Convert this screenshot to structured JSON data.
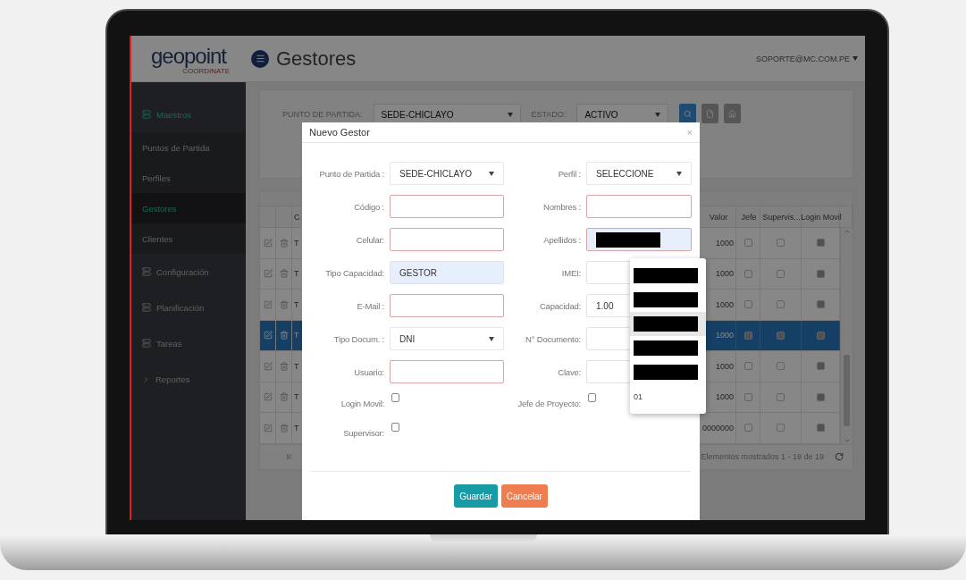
{
  "header": {
    "logo": "geopoint",
    "logo_tagline": "COORDINATE",
    "title": "Gestores",
    "user": "SOPORTE@MC.COM.PE"
  },
  "sidebar": {
    "items": [
      {
        "label": "Maestros",
        "kind": "section",
        "selected": true
      },
      {
        "label": "Puntos de Partida",
        "kind": "link",
        "selected": false
      },
      {
        "label": "Perfiles",
        "kind": "link",
        "selected": false
      },
      {
        "label": "Gestores",
        "kind": "link",
        "selected": true
      },
      {
        "label": "Clientes",
        "kind": "link",
        "selected": false
      },
      {
        "label": "Configuración",
        "kind": "section",
        "selected": false
      },
      {
        "label": "Planificación",
        "kind": "section",
        "selected": false
      },
      {
        "label": "Tareas",
        "kind": "section",
        "selected": false
      },
      {
        "label": "Reportes",
        "kind": "group",
        "selected": false
      }
    ]
  },
  "filters": [
    {
      "label": "PUNTO DE PARTIDA:",
      "value": "SEDE-CHICLAYO"
    },
    {
      "label": "ESTADO:",
      "value": "ACTIVO"
    }
  ],
  "filter_buttons": [
    {
      "kind": "search"
    },
    {
      "kind": "new"
    },
    {
      "kind": "home"
    }
  ],
  "table": {
    "columns": [
      "C",
      "Valor",
      "Jefe",
      "Supervis...",
      "Login Movil"
    ],
    "rows": [
      {
        "column_3": "T",
        "valor": "1000",
        "jefe": false,
        "supervisor": false,
        "login_movil": true,
        "selected": false
      },
      {
        "column_3": "T",
        "valor": "1000",
        "jefe": false,
        "supervisor": false,
        "login_movil": true,
        "selected": false
      },
      {
        "column_3": "T",
        "valor": "1000",
        "jefe": false,
        "supervisor": false,
        "login_movil": true,
        "selected": false
      },
      {
        "column_3": "T",
        "valor": "1000",
        "jefe": true,
        "supervisor": true,
        "login_movil": true,
        "selected": true
      },
      {
        "column_3": "T",
        "valor": "1000",
        "jefe": false,
        "supervisor": false,
        "login_movil": true,
        "selected": false
      },
      {
        "column_3": "T",
        "valor": "1000",
        "jefe": false,
        "supervisor": false,
        "login_movil": true,
        "selected": false
      },
      {
        "column_3": "T",
        "valor": "0000000",
        "jefe": false,
        "supervisor": false,
        "login_movil": true,
        "selected": false
      }
    ],
    "footer": "Elementos mostrados 1 - 19 de 19"
  },
  "modal": {
    "title": "Nuevo Gestor",
    "close": "×",
    "rows": [
      {
        "left": {
          "label": "Punto de Partida :",
          "kind": "select",
          "value": "SEDE-CHICLAYO"
        },
        "right": {
          "label": "Perfil :",
          "kind": "select",
          "value": "SELECCIONE"
        }
      },
      {
        "left": {
          "label": "Código :",
          "kind": "input",
          "invalid": true,
          "highlighted": false
        },
        "right": {
          "label": "Nombres :",
          "kind": "input",
          "invalid": true,
          "highlighted": false
        }
      },
      {
        "left": {
          "label": "Celular:",
          "kind": "input",
          "invalid": true,
          "highlighted": false
        },
        "right": {
          "label": "Apellidos :",
          "kind": "input",
          "invalid": true,
          "highlighted": true,
          "redacted": true
        }
      },
      {
        "left": {
          "label": "Tipo Capacidad:",
          "kind": "input",
          "value": "GESTOR",
          "invalid": false,
          "highlighted": true
        },
        "right": {
          "label": "IMEI:",
          "kind": "input",
          "invalid": false,
          "highlighted": false
        }
      },
      {
        "left": {
          "label": "E-Mail :",
          "kind": "input",
          "invalid": true,
          "highlighted": false
        },
        "right": {
          "label": "Capacidad:",
          "kind": "input",
          "value": "1.00",
          "invalid": false,
          "highlighted": false
        }
      },
      {
        "left": {
          "label": "Tipo Docum. :",
          "kind": "select",
          "value": "DNI"
        },
        "right": {
          "label": "N° Documento:",
          "kind": "input",
          "invalid": false,
          "highlighted": false
        }
      },
      {
        "left": {
          "label": "Usuario:",
          "kind": "input",
          "invalid": true,
          "highlighted": false
        },
        "right": {
          "label": "Clave:",
          "kind": "input",
          "invalid": false,
          "highlighted": false
        }
      },
      {
        "left": {
          "label": "Login Movil:",
          "kind": "checkbox",
          "checked": false
        },
        "right": {
          "label": "Jefe de Proyecto:",
          "kind": "checkbox",
          "checked": false
        }
      },
      {
        "left": {
          "label": "Supervisor:",
          "kind": "checkbox",
          "checked": false
        }
      }
    ],
    "buttons": [
      {
        "label": "Guardar",
        "kind": "primary"
      },
      {
        "label": "Cancelar",
        "kind": "cancel"
      }
    ]
  },
  "autocomplete": {
    "items": [
      {
        "kind": "redacted",
        "highlighted": false
      },
      {
        "kind": "redacted",
        "highlighted": false
      },
      {
        "kind": "redacted",
        "highlighted": true
      },
      {
        "kind": "redacted",
        "highlighted": false
      },
      {
        "kind": "redacted",
        "highlighted": false
      },
      {
        "kind": "text",
        "text": "01",
        "highlighted": false
      }
    ]
  }
}
